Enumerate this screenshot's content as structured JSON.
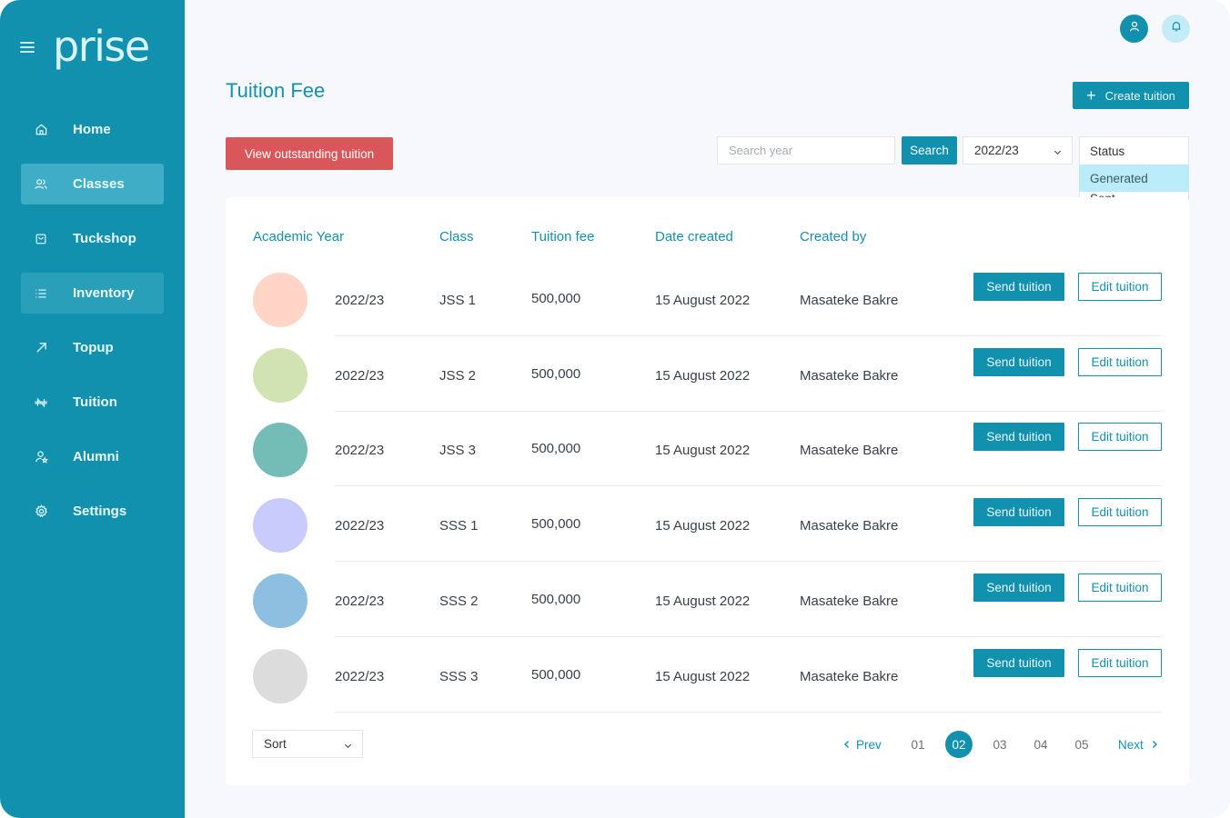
{
  "app": {
    "logo": "prise"
  },
  "sidebar": {
    "items": [
      {
        "label": "Home",
        "icon": "home-icon"
      },
      {
        "label": "Classes",
        "icon": "users-icon"
      },
      {
        "label": "Tuckshop",
        "icon": "shopping-bag-icon"
      },
      {
        "label": "Inventory",
        "icon": "list-icon"
      },
      {
        "label": "Topup",
        "icon": "arrow-up-right-icon"
      },
      {
        "label": "Tuition",
        "icon": "naira-icon"
      },
      {
        "label": "Alumni",
        "icon": "user-star-icon"
      },
      {
        "label": "Settings",
        "icon": "gear-icon"
      }
    ]
  },
  "header": {
    "title": "Tuition Fee",
    "create_label": "Create tuition",
    "create_icon": "plus-icon"
  },
  "toolbar": {
    "outstanding_label": "View outstanding tuition",
    "search_placeholder": "Search year",
    "search_value": "",
    "search_label": "Search",
    "year_value": "2022/23",
    "status": {
      "label": "Status",
      "options": [
        "Generated",
        "Sent"
      ],
      "highlighted": "Generated"
    }
  },
  "table": {
    "columns": [
      "Academic Year",
      "Class",
      "Tuition fee",
      "Date created",
      "Created by"
    ],
    "rows": [
      {
        "year": "2022/23",
        "class": "JSS 1",
        "fee": "500,000",
        "date": "15 August 2022",
        "creator": "Masateke Bakre",
        "color": "#ffd5c8"
      },
      {
        "year": "2022/23",
        "class": "JSS 2",
        "fee": "500,000",
        "date": "15 August 2022",
        "creator": "Masateke Bakre",
        "color": "#d1e2b3"
      },
      {
        "year": "2022/23",
        "class": "JSS 3",
        "fee": "500,000",
        "date": "15 August 2022",
        "creator": "Masateke Bakre",
        "color": "#74bdb7"
      },
      {
        "year": "2022/23",
        "class": "SSS 1",
        "fee": "500,000",
        "date": "15 August 2022",
        "creator": "Masateke Bakre",
        "color": "#cacbfd"
      },
      {
        "year": "2022/23",
        "class": "SSS 2",
        "fee": "500,000",
        "date": "15 August 2022",
        "creator": "Masateke Bakre",
        "color": "#8cbfe0"
      },
      {
        "year": "2022/23",
        "class": "SSS 3",
        "fee": "500,000",
        "date": "15 August 2022",
        "creator": "Masateke Bakre",
        "color": "#dcdcdc"
      }
    ],
    "send_label": "Send tuition",
    "edit_label": "Edit tuition"
  },
  "footer": {
    "sort_label": "Sort",
    "prev_label": "Prev",
    "next_label": "Next",
    "pages": [
      "01",
      "02",
      "03",
      "04",
      "05"
    ],
    "current_page": "02"
  },
  "colors": {
    "brand": "#1291ae",
    "danger": "#d9575b",
    "highlight": "#b9ecf8"
  }
}
